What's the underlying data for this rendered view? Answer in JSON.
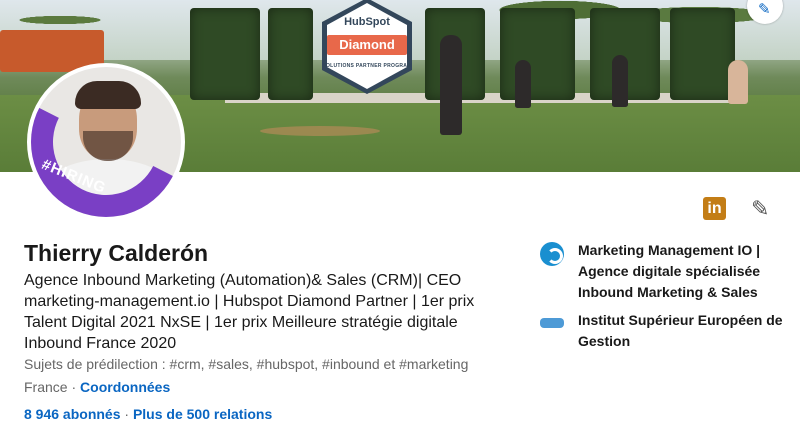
{
  "cover": {
    "badge": {
      "brand": "HubSpot",
      "tier": "Diamond",
      "subtitle": "SOLUTIONS PARTNER PROGRAM"
    },
    "edit_icon": "pencil-icon"
  },
  "avatar": {
    "ring_label": "#HIRING",
    "ring_color": "#7a3fc5"
  },
  "actions": {
    "linkedin_icon": "in",
    "edit_icon": "pencil-icon"
  },
  "profile": {
    "name": "Thierry Calderón",
    "headline": "Agence Inbound Marketing (Automation)& Sales (CRM)| CEO marketing-management.io | Hubspot Diamond Partner | 1er prix Talent Digital 2021 NxSE | 1er prix Meilleure stratégie digitale Inbound France 2020",
    "topics": "Sujets de prédilection : #crm, #sales, #hubspot, #inbound et #marketing",
    "location": "France",
    "separator": " · ",
    "contact_link": "Coordonnées",
    "followers": "8 946 abonnés",
    "connections": "Plus de 500 relations"
  },
  "experience": [
    {
      "logo": "marketing-management-logo",
      "label": "Marketing Management IO | Agence digitale spécialisée Inbound Marketing & Sales"
    },
    {
      "logo": "isegs-logo",
      "label": "Institut Supérieur Européen de Gestion"
    }
  ],
  "colors": {
    "link": "#0a66c2",
    "text": "#191919",
    "muted": "#666666",
    "badge_accent": "#e8684a"
  }
}
